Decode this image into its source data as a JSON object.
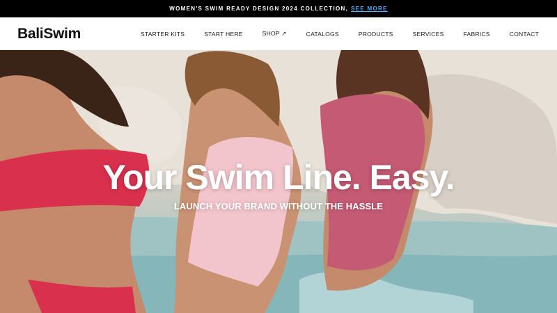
{
  "announcement": {
    "text": "WOMEN'S SWIM READY DESIGN 2024 COLLECTION,",
    "link": "SEE MORE"
  },
  "header": {
    "logo": "BaliSwim",
    "nav": [
      {
        "label": "STARTER KITS"
      },
      {
        "label": "START HERE"
      },
      {
        "label": "SHOP ↗"
      },
      {
        "label": "CATALOGS"
      },
      {
        "label": "PRODUCTS"
      },
      {
        "label": "SERVICES"
      },
      {
        "label": "FABRICS"
      },
      {
        "label": "CONTACT"
      }
    ]
  },
  "hero": {
    "title": "Your Swim Line. Easy.",
    "subtitle": "LAUNCH YOUR BRAND WITHOUT THE HASSLE"
  },
  "colors": {
    "announcement_bg": "#000000",
    "link": "#4fb3ff",
    "swimsuit_red": "#d9304d",
    "swimsuit_pink": "#f2c4cc",
    "swimsuit_rose": "#c45a73",
    "water": "#8cb8bc"
  }
}
